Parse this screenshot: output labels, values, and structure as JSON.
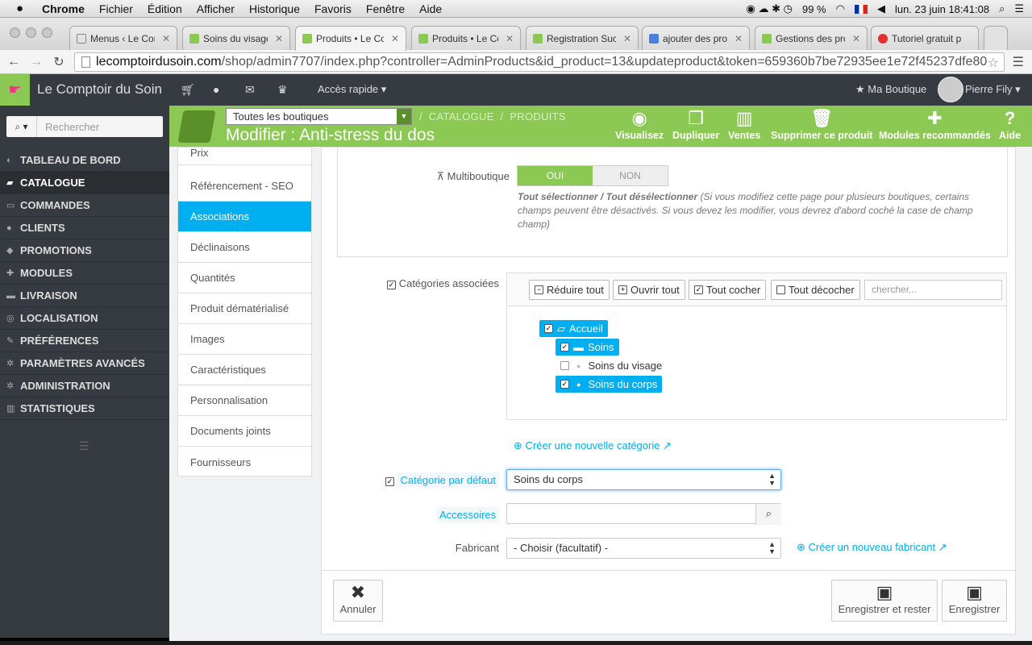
{
  "mac": {
    "app": "Chrome",
    "menus": [
      "Fichier",
      "Édition",
      "Afficher",
      "Historique",
      "Favoris",
      "Fenêtre",
      "Aide"
    ],
    "battery": "99 %",
    "datetime": "lun. 23 juin  18:41:08"
  },
  "tabs": [
    {
      "title": "Menus ‹ Le Comp",
      "color": "#ffffff"
    },
    {
      "title": "Soins du visage",
      "color": "#8bc954"
    },
    {
      "title": "Produits • Le Co",
      "color": "#8bc954"
    },
    {
      "title": "Produits • Le Co",
      "color": "#8bc954"
    },
    {
      "title": "Registration Succ",
      "color": "#8bc954"
    },
    {
      "title": "ajouter des prod",
      "color": "#4a7fe0"
    },
    {
      "title": "Gestions des pro",
      "color": "#8bc954"
    },
    {
      "title": "Tutoriel gratuit p",
      "color": "#e03030"
    }
  ],
  "url": {
    "host": "lecomptoirdusoin.com",
    "path": "/shop/admin7707/index.php?controller=AdminProducts&id_product=13&updateproduct&token=659360b7be72935ee1e72f45237dfe80"
  },
  "topbar": {
    "shop_name": "Le Comptoir du Soin",
    "quick_access": "Accès rapide",
    "my_shop": "Ma Boutique",
    "user": "Pierre Fily"
  },
  "sidebar": {
    "search_placeholder": "Rechercher",
    "items": [
      {
        "label": "Tableau de bord",
        "icon": "dashboard-icon"
      },
      {
        "label": "Catalogue",
        "icon": "book-icon"
      },
      {
        "label": "Commandes",
        "icon": "credit-card-icon"
      },
      {
        "label": "Clients",
        "icon": "users-icon"
      },
      {
        "label": "Promotions",
        "icon": "tag-icon"
      },
      {
        "label": "Modules",
        "icon": "puzzle-icon"
      },
      {
        "label": "Livraison",
        "icon": "truck-icon"
      },
      {
        "label": "Localisation",
        "icon": "globe-icon"
      },
      {
        "label": "Préférences",
        "icon": "wrench-icon"
      },
      {
        "label": "Paramètres avancés",
        "icon": "cogs-icon"
      },
      {
        "label": "Administration",
        "icon": "cog-icon"
      },
      {
        "label": "Statistiques",
        "icon": "bar-chart-icon"
      }
    ]
  },
  "header": {
    "shop_select": "Toutes les boutiques",
    "breadcrumb": [
      "CATALOGUE",
      "PRODUITS"
    ],
    "title": "Modifier : Anti-stress du dos",
    "toolbar": [
      {
        "label": "Visualisez",
        "icon": "eye-icon"
      },
      {
        "label": "Dupliquer",
        "icon": "copy-icon"
      },
      {
        "label": "Ventes",
        "icon": "bar-chart-icon"
      },
      {
        "label": "Supprimer ce produit",
        "icon": "trash-icon"
      },
      {
        "label": "Modules recommandés",
        "icon": "puzzle-icon"
      },
      {
        "label": "Aide",
        "icon": "help-icon"
      }
    ]
  },
  "product_tabs": [
    "Prix",
    "Référencement - SEO",
    "Associations",
    "Déclinaisons",
    "Quantités",
    "Produit dématérialisé",
    "Images",
    "Caractéristiques",
    "Personnalisation",
    "Documents joints",
    "Fournisseurs"
  ],
  "form": {
    "multishop_label": "Multiboutique",
    "toggle_on": "OUI",
    "toggle_off": "NON",
    "help_bold": "Tout sélectionner / Tout désélectionner",
    "help_text": " (Si vous modifiez cette page pour plusieurs boutiques, certains champs peuvent être désactivés. Si vous devez les modifier, vous devrez d'abord coché la case de champ champ)",
    "categories_label": "Catégories associées",
    "btn_collapse": "Réduire tout",
    "btn_expand": "Ouvrir tout",
    "btn_check_all": "Tout cocher",
    "btn_uncheck_all": "Tout décocher",
    "cat_search_placeholder": "chercher...",
    "tree": [
      "Accueil",
      "Soins",
      "Soins du visage",
      "Soins du corps"
    ],
    "new_category": "Créer une nouvelle catégorie",
    "default_category_label": "Catégorie par défaut",
    "default_category_value": "Soins du corps",
    "accessories_label": "Accessoires",
    "manufacturer_label": "Fabricant",
    "manufacturer_value": "- Choisir (facultatif) -",
    "new_manufacturer": "Créer un nouveau fabricant",
    "cancel": "Annuler",
    "save_stay": "Enregistrer et rester",
    "save": "Enregistrer"
  }
}
